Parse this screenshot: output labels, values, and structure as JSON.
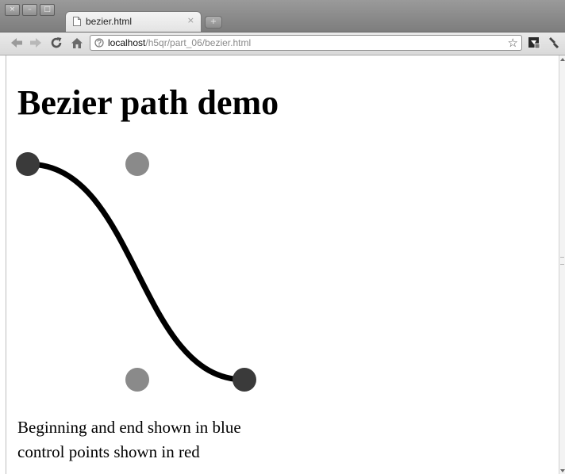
{
  "browser": {
    "tab": {
      "title": "bezier.html",
      "close_label": "×",
      "new_tab_label": "+"
    },
    "window_controls": {
      "close": "×",
      "minimize": "–",
      "maximize": "□"
    },
    "url": {
      "host": "localhost",
      "path": "/h5qr/part_06/bezier.html"
    },
    "icons": {
      "back": "back-arrow-icon",
      "forward": "forward-arrow-icon",
      "reload": "reload-icon",
      "home": "home-icon",
      "page": "page-icon",
      "bookmark": "star-icon",
      "extension": "extension-icon",
      "menu": "wrench-icon"
    }
  },
  "page": {
    "title": "Bezier path demo",
    "caption_line1": "Beginning and end shown in blue",
    "caption_line2": "control points shown in red"
  },
  "colors": {
    "endpoint": "#3a3a3a",
    "control_point": "#8a8a8a",
    "curve": "#000000"
  }
}
